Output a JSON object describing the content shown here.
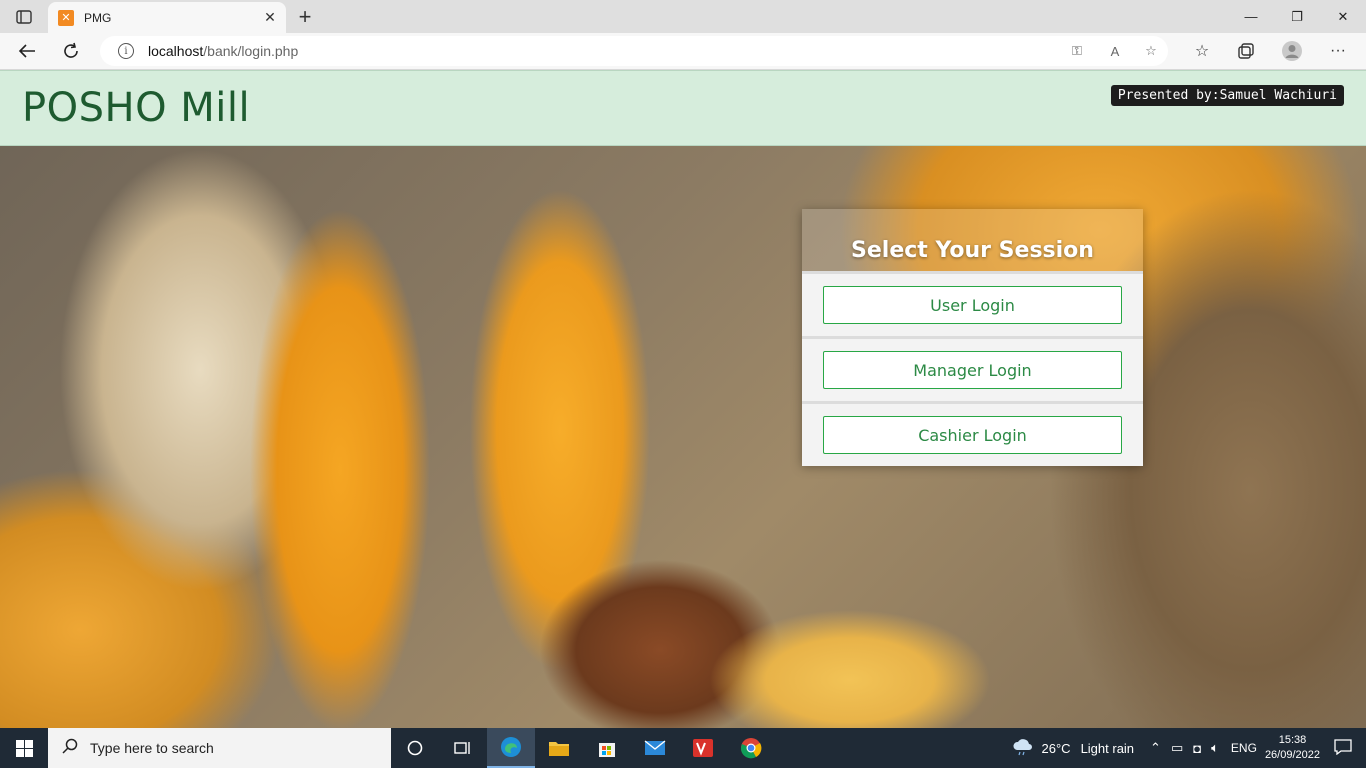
{
  "browser": {
    "tab_title": "PMG",
    "url_host": "localhost",
    "url_path": "/bank/login.php"
  },
  "page": {
    "site_title": "POSHO Mill",
    "presented_by": "Presented by:Samuel Wachiuri",
    "session": {
      "title": "Select Your Session",
      "buttons": [
        "User Login",
        "Manager Login",
        "Cashier Login"
      ]
    }
  },
  "taskbar": {
    "search_placeholder": "Type here to search",
    "weather_temp": "26°C",
    "weather_desc": "Light rain",
    "language": "ENG",
    "time": "15:38",
    "date": "26/09/2022"
  },
  "colors": {
    "header_bg": "#d6eddc",
    "title_green": "#1e5b30",
    "button_border": "#28a745"
  }
}
